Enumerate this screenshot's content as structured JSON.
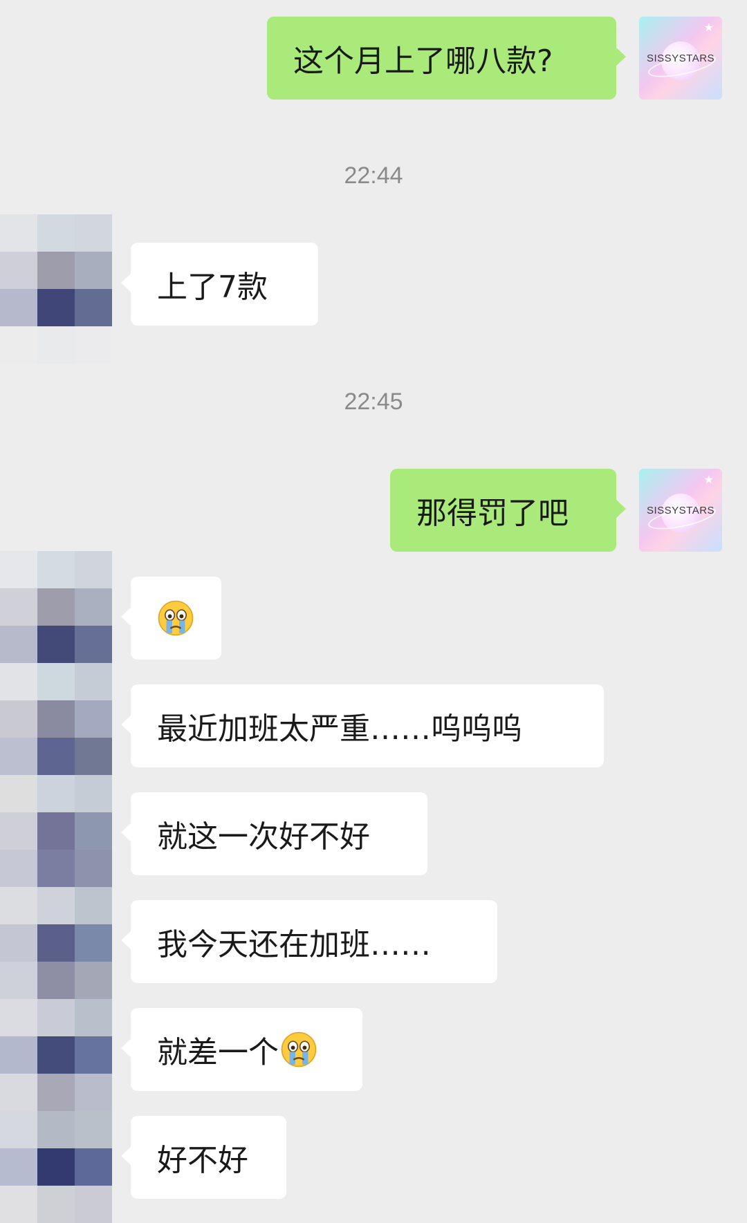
{
  "me": {
    "avatar_text": "SISSYSTARS",
    "avatar_star": "★"
  },
  "timestamps": [
    "22:44",
    "22:45"
  ],
  "messages": {
    "m1": "这个月上了哪八款?",
    "m2": "上了7款",
    "m3": "那得罚了吧",
    "m4_emoji": "crying-face",
    "m5": "最近加班太严重……呜呜呜",
    "m6": "就这一次好不好",
    "m7": "我今天还在加班……",
    "m8": "就差一个",
    "m8_emoji": "crying-face",
    "m9": "好不好"
  },
  "colors": {
    "background": "#ededed",
    "outgoing_bubble": "#a9ea7a",
    "incoming_bubble": "#ffffff",
    "timestamp_text": "#8a8a8a"
  }
}
